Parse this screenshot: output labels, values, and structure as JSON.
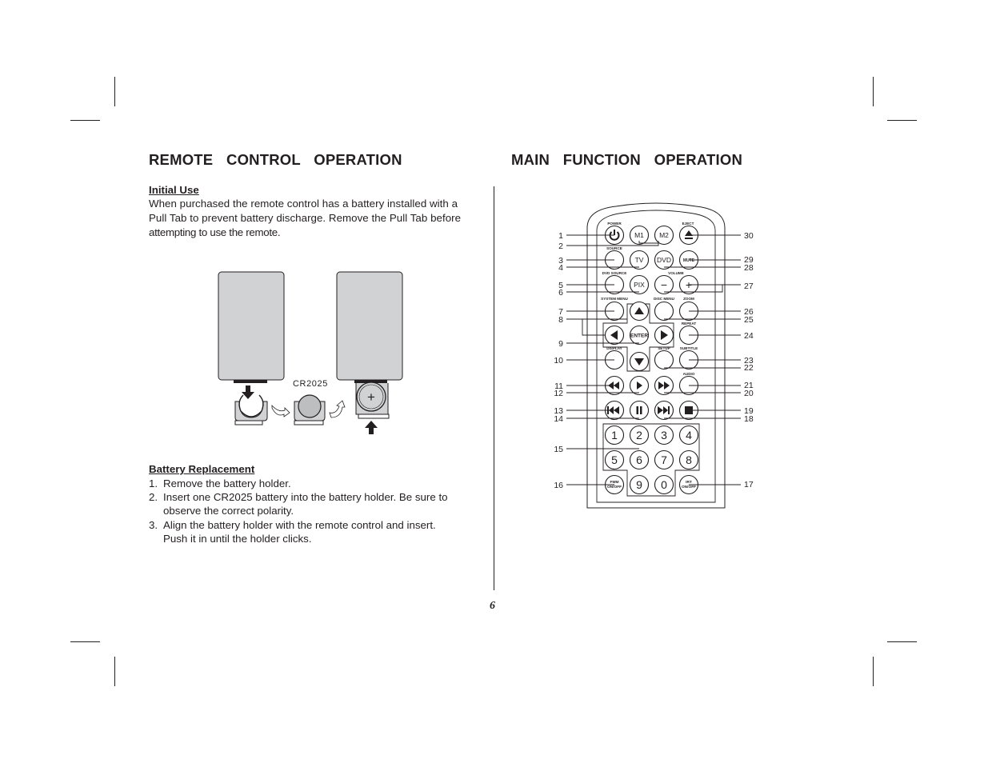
{
  "left_section": {
    "title": "REMOTE  CONTROL  OPERATION",
    "initial_use": {
      "heading": "Initial Use",
      "lines": [
        "When purchased the remote control has a battery installed with a",
        "Pull Tab to prevent battery discharge. Remove the Pull Tab before",
        "attempting to use the remote."
      ]
    },
    "figure": {
      "battery_label": "CR2025",
      "plus_sign": "+"
    },
    "battery_replacement": {
      "heading": "Battery Replacement",
      "steps": [
        {
          "num": "1.",
          "lines": [
            "Remove the battery holder."
          ]
        },
        {
          "num": "2.",
          "lines": [
            "Insert one CR2025 battery into the battery holder. Be sure to",
            "observe the correct polarity."
          ]
        },
        {
          "num": "3.",
          "lines": [
            "Align the battery holder with the remote control and insert.",
            "Push it in until the holder clicks."
          ]
        }
      ]
    }
  },
  "right_section": {
    "title": "MAIN  FUNCTION  OPERATION",
    "remote": {
      "labels": {
        "power": "POWER",
        "eject": "EJECT",
        "source": "SOURCE",
        "dvd_source": "DVD SOURCE",
        "volume": "VOLUME",
        "system_menu": "SYSTEM MENU",
        "disc_menu": "DISC MENU",
        "zoom": "ZOOM",
        "repeat": "REPEAT",
        "display": "DISPLAY",
        "setup": "SETUP",
        "subtitle": "SUBTITLE",
        "audio": "AUDIO"
      },
      "buttons": {
        "m1": "M1",
        "m2": "M2",
        "tv": "TV",
        "dvd": "DVD",
        "mute": "MUTE",
        "pix": "PIX",
        "minus": "−",
        "plus": "+",
        "enter": "ENTER",
        "fmm_1": "FMM",
        "fmm_2": "ON/OFF",
        "irt_1": "IRT",
        "irt_2": "ON/OFF",
        "digits": [
          "1",
          "2",
          "3",
          "4",
          "5",
          "6",
          "7",
          "8",
          "9",
          "0"
        ]
      },
      "callouts_left": [
        "1",
        "2",
        "3",
        "4",
        "5",
        "6",
        "7",
        "8",
        "9",
        "10",
        "11",
        "12",
        "13",
        "14",
        "15",
        "16"
      ],
      "callouts_right": [
        "30",
        "29",
        "28",
        "27",
        "26",
        "25",
        "24",
        "23",
        "22",
        "21",
        "20",
        "19",
        "18",
        "17"
      ]
    }
  },
  "page_number": "6"
}
